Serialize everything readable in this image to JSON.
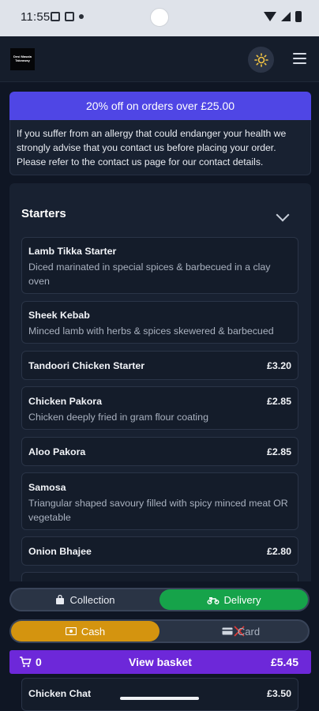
{
  "status_bar": {
    "time": "11:55"
  },
  "header": {
    "logo_text": "Desi Masala Takeaway"
  },
  "promo": {
    "text": "20% off on orders over £25.00"
  },
  "allergy_notice": {
    "text": "If you suffer from an allergy that could endanger your health we strongly advise that you contact us before placing your order. Please refer to the contact us page for our contact details."
  },
  "menu": {
    "section_title": "Starters",
    "items": [
      {
        "name": "Lamb Tikka Starter",
        "description": "Diced marinated in special spices & barbecued in a clay oven",
        "price": ""
      },
      {
        "name": "Sheek Kebab",
        "description": "Minced lamb with herbs & spices skewered & barbecued",
        "price": ""
      },
      {
        "name": "Tandoori Chicken Starter",
        "description": "",
        "price": "£3.20"
      },
      {
        "name": "Chicken Pakora",
        "description": "Chicken deeply fried in gram flour coating",
        "price": "£2.85"
      },
      {
        "name": "Aloo Pakora",
        "description": "",
        "price": "£2.85"
      },
      {
        "name": "Samosa",
        "description": "Triangular shaped savoury filled with spicy minced meat OR vegetable",
        "price": ""
      },
      {
        "name": "Onion Bhajee",
        "description": "",
        "price": "£2.80"
      }
    ],
    "peek_item": {
      "name": "Chicken Chat",
      "price": "£3.50"
    }
  },
  "order_type": {
    "collection_label": "Collection",
    "delivery_label": "Delivery",
    "selected": "Delivery"
  },
  "payment": {
    "cash_label": "Cash",
    "card_label": "Card",
    "selected": "Cash"
  },
  "basket": {
    "count": "0",
    "label": "View basket",
    "total": "£5.45"
  },
  "colors": {
    "promo": "#4f46e5",
    "delivery": "#16a34a",
    "cash": "#d4940f",
    "basket": "#6d28d9"
  }
}
